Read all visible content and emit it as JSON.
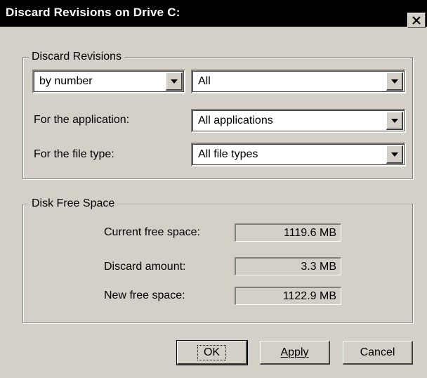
{
  "window": {
    "title": "Discard Revisions on Drive C:"
  },
  "discard_group": {
    "legend": "Discard Revisions",
    "method_value": "by number",
    "amount_value": "All",
    "application_label": "For the application:",
    "application_value": "All applications",
    "filetype_label": "For the file type:",
    "filetype_value": "All file types"
  },
  "space_group": {
    "legend": "Disk Free Space",
    "current_label": "Current free space:",
    "current_value": "1119.6 MB",
    "discard_label": "Discard amount:",
    "discard_value": "3.3 MB",
    "new_label": "New free space:",
    "new_value": "1122.9 MB"
  },
  "buttons": {
    "ok": "OK",
    "apply": "Apply",
    "cancel": "Cancel"
  },
  "icons": {
    "close": "close-icon",
    "dropdown": "chevron-down-icon"
  },
  "colors": {
    "face": "#d4d0c8",
    "titlebar": "#000000",
    "title_text": "#ffffff"
  }
}
